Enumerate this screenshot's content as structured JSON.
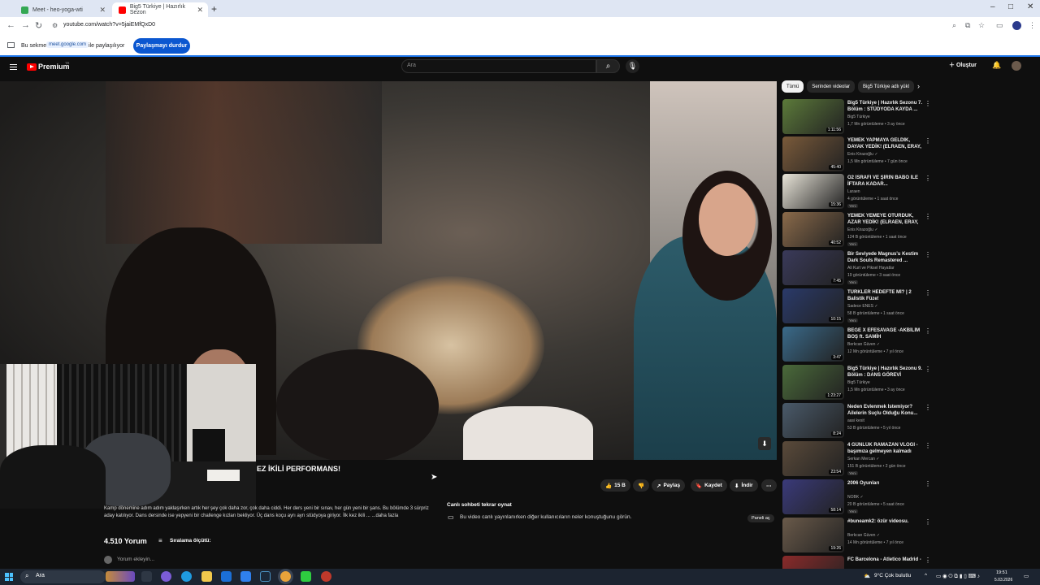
{
  "browser": {
    "tabs": [
      {
        "title": "Meet - heo-yoga-wti",
        "favicon_color": "#34a853",
        "active": false
      },
      {
        "title": "Big5 Türkiye | Hazırlık Sezon",
        "favicon_color": "#ff0000",
        "active": true
      }
    ],
    "url": "youtube.com/watch?v=5jaiEMfQxD0",
    "share_bar": {
      "text_prefix": "Bu sekme",
      "domain": "meet.google.com",
      "text_suffix": "ile paylaşılıyor",
      "stop_button": "Paylaşmayı durdur"
    }
  },
  "youtube": {
    "logo": "Premium",
    "logo_sup": "TR",
    "search_placeholder": "Ara",
    "create_label": "Oluştur",
    "video": {
      "title_visible": "EZ İKİLİ PERFORMANS!",
      "likes": "15 B",
      "share": "Paylaş",
      "save": "Kaydet",
      "download": "İndir",
      "description": "Kamp dönemine adım adım yaklaşırken artık her şey çok daha zor, çok daha ciddi. Her ders yeni bir sınav, her gün yeni bir şans. Bu bölümde 3 sürpriz aday katılıyor. Dans dersinde ise yepyeni bir challenge kızları bekliyor. Üç dans koçu ayrı ayrı stüdyoya giriyor. İlk kez ikili ... ...daha fazla"
    },
    "live_chat": {
      "title": "Canlı sohbeti tekrar oynat",
      "text": "Bu video canlı yayınlanırken diğer kullanıcıların neler konuştuğunu görün.",
      "button": "Paneli aç"
    },
    "comments": {
      "count": "4.510 Yorum",
      "sort_label": "Sıralama ölçütü:",
      "placeholder": "Yorum ekleyin..."
    },
    "chips": [
      "Tümü",
      "Serinden videolar",
      "Big5 Türkiye adlı yükl"
    ],
    "recommendations": [
      {
        "title": "Big5 Türkiye | Hazırlık Sezonu 7. Bölüm : STÜDYODA KAYDA ...",
        "channel": "Big5 Türkiye",
        "meta": "1,7 Mn görüntüleme • 3 ay önce",
        "duration": "1:11:56",
        "new": "",
        "color": "#5c7a3a"
      },
      {
        "title": "YEMEK YAPMAYA GELDİK, DAYAK YEDİK! (ELRAEN, ERAY, ...",
        "channel": "Enis Kirazoğlu ✓",
        "meta": "1,5 Mn görüntüleme • 7 gün önce",
        "duration": "45:40",
        "new": "",
        "color": "#7a5a3a"
      },
      {
        "title": "O2 İSRAFI VE ŞİRİN BABO İLE İFTARA KADAR...",
        "channel": "Laraen",
        "meta": "4 görüntüleme • 1 saat önce",
        "duration": "15:36",
        "new": "Yeni",
        "color": "#e8e4d8"
      },
      {
        "title": "YEMEK YEMEYE OTURDUK, AZAR YEDİK! (ELRAEN, ERAY, ...",
        "channel": "Enis Kirazoğlu ✓",
        "meta": "124 B görüntüleme • 1 saat önce",
        "duration": "40:52",
        "new": "Yeni",
        "color": "#8a6a4a"
      },
      {
        "title": "Bir Seviyede Magnus'u Kestim Dark Souls Remastered ...",
        "channel": "Ali Kurt ve Piksel Hayatlar",
        "meta": "19 görüntüleme • 3 saat önce",
        "duration": "7:45",
        "new": "Yeni",
        "color": "#3a3a5a"
      },
      {
        "title": "TÜRKLER HEDEFTE Mİ? | 2 Balistik Füze!",
        "channel": "Sadece ENES ✓",
        "meta": "58 B görüntüleme • 1 saat önce",
        "duration": "10:15",
        "new": "Yeni",
        "color": "#2a3a6a"
      },
      {
        "title": "BEGE X EFESAVAGE -AKBİLİM BOŞ ft. SAMİH",
        "channel": "Berkcan Güven ✓",
        "meta": "12 Mn görüntüleme • 7 yıl önce",
        "duration": "3:47",
        "new": "",
        "color": "#3a6a8a"
      },
      {
        "title": "Big5 Türkiye | Hazırlık Sezonu 9. Bölüm : DANS GÖREVİ",
        "channel": "Big5 Türkiye",
        "meta": "1,5 Mn görüntüleme • 3 ay önce",
        "duration": "1:23:27",
        "new": "",
        "color": "#4a6a3a"
      },
      {
        "title": "Neden Evlenmek İstemiyor? Ailelerin Suçlu Olduğu Konu...",
        "channel": "aasi kesit",
        "meta": "53 B görüntüleme • 5 yıl önce",
        "duration": "8:24",
        "new": "",
        "color": "#4a5a6a"
      },
      {
        "title": "4 GÜNLÜK RAMAZAN VLOGI - başımıza gelmeyen kalmadı",
        "channel": "Serkan Mercan ✓",
        "meta": "151 B görüntüleme • 2 gün önce",
        "duration": "23:54",
        "new": "Yeni",
        "color": "#5a4a3a"
      },
      {
        "title": "2006 Oyunları",
        "channel": "NOBK ✓",
        "meta": "20 B görüntüleme • 5 saat önce",
        "duration": "58:14",
        "new": "Yeni",
        "color": "#3a3a7a"
      },
      {
        "title": "#buneamk2: özür videosu.",
        "channel": "Berkcan Güven ✓",
        "meta": "14 Mn görüntüleme • 7 yıl önce",
        "duration": "19:26",
        "new": "",
        "color": "#6a5a4a"
      },
      {
        "title": "FC Barcelona - Atletico Madrid -",
        "channel": "",
        "meta": "",
        "duration": "",
        "new": "",
        "color": "#8a2a2a"
      }
    ]
  },
  "taskbar": {
    "search": "Ara",
    "weather": "9°C Çok bulutlu",
    "time": "19:51",
    "date": "5.03.2026"
  }
}
